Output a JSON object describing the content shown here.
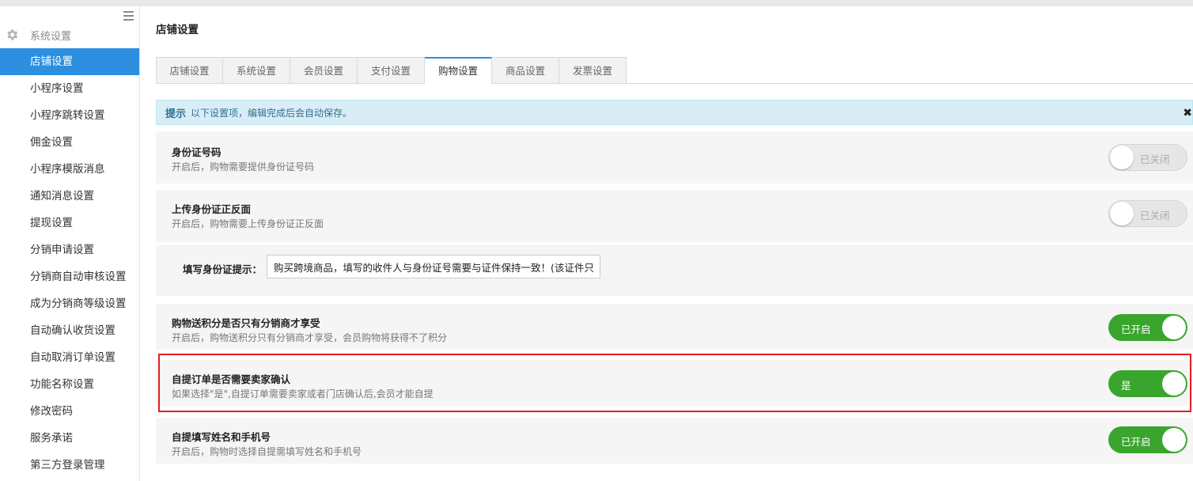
{
  "sidebar": {
    "section_label": "系统设置",
    "section_icon": "gear-icon",
    "menu_icon": "hamburger-menu-icon",
    "items": [
      {
        "label": "店铺设置",
        "active": true
      },
      {
        "label": "小程序设置"
      },
      {
        "label": "小程序跳转设置"
      },
      {
        "label": "佣金设置"
      },
      {
        "label": "小程序模版消息"
      },
      {
        "label": "通知消息设置"
      },
      {
        "label": "提现设置"
      },
      {
        "label": "分销申请设置"
      },
      {
        "label": "分销商自动审核设置"
      },
      {
        "label": "成为分销商等级设置"
      },
      {
        "label": "自动确认收货设置"
      },
      {
        "label": "自动取消订单设置"
      },
      {
        "label": "功能名称设置"
      },
      {
        "label": "修改密码"
      },
      {
        "label": "服务承诺"
      },
      {
        "label": "第三方登录管理"
      }
    ]
  },
  "main": {
    "title": "店铺设置",
    "tabs": [
      {
        "label": "店铺设置"
      },
      {
        "label": "系统设置"
      },
      {
        "label": "会员设置"
      },
      {
        "label": "支付设置"
      },
      {
        "label": "购物设置",
        "active": true
      },
      {
        "label": "商品设置"
      },
      {
        "label": "发票设置"
      }
    ],
    "tip": {
      "label": "提示",
      "text": "以下设置项，编辑完成后会自动保存。",
      "close": "✖"
    },
    "settings": {
      "id_number": {
        "title": "身份证号码",
        "desc": "开启后，购物需要提供身份证号码",
        "state": "已关闭"
      },
      "id_upload": {
        "title": "上传身份证正反面",
        "desc": "开启后，购物需要上传身份证正反面",
        "state": "已关闭"
      },
      "id_hint": {
        "label": "填写身份证提示：",
        "value": "购买跨境商品，填写的收件人与身份证号需要与证件保持一致！(该证件只用"
      },
      "points_distributor": {
        "title": "购物送积分是否只有分销商才享受",
        "desc": "开启后，购物送积分只有分销商才享受，会员购物将获得不了积分",
        "state": "已开启"
      },
      "pickup_confirm": {
        "title": "自提订单是否需要卖家确认",
        "desc": "如果选择\"是\",自提订单需要卖家或者门店确认后,会员才能自提",
        "state": "是"
      },
      "pickup_contact": {
        "title": "自提填写姓名和手机号",
        "desc": "开启后，购物时选择自提需填写姓名和手机号",
        "state": "已开启"
      }
    }
  },
  "colors": {
    "accent": "#2d8fe0",
    "switch_on": "#3aa52d",
    "highlight": "#e02020",
    "tip_bg": "#d9edf7"
  }
}
